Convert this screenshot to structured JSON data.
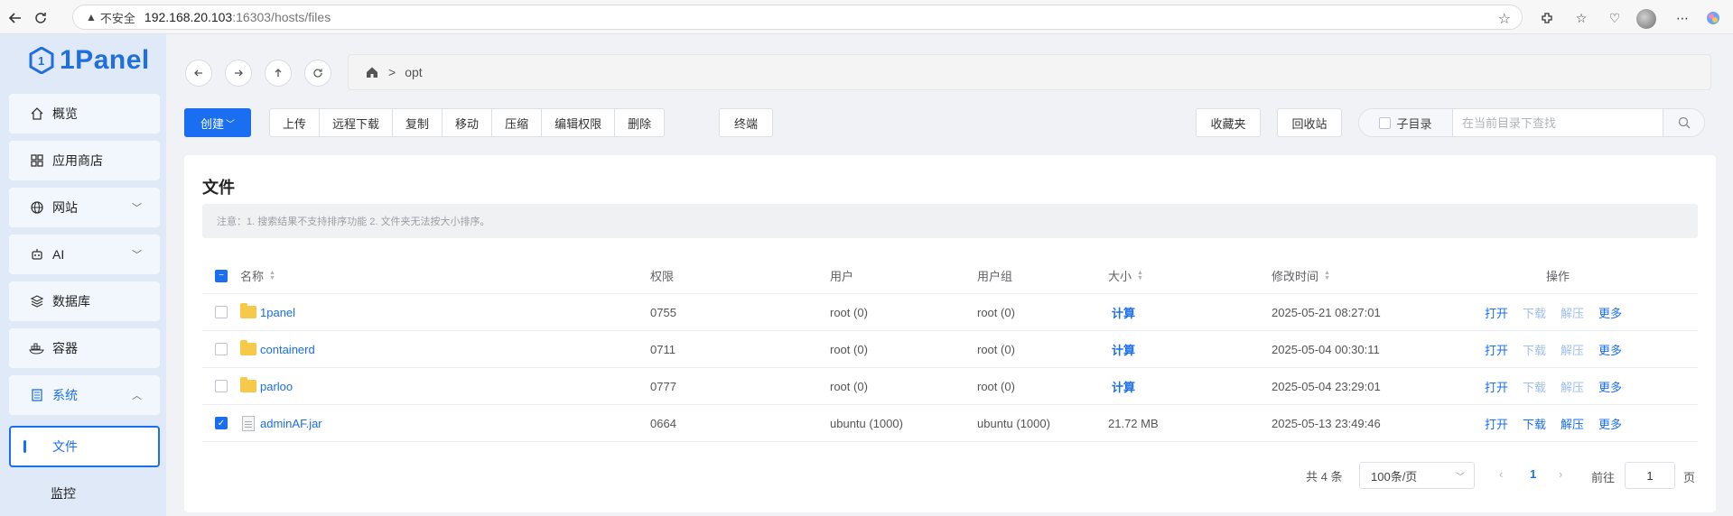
{
  "browser": {
    "insecure_label": "不安全",
    "url_host": "192.168.20.103",
    "url_rest": ":16303/hosts/files"
  },
  "sidebar": {
    "logo_text": "1Panel",
    "items": [
      {
        "label": "概览",
        "icon": "home-icon"
      },
      {
        "label": "应用商店",
        "icon": "apps-grid-icon"
      },
      {
        "label": "网站",
        "icon": "globe-icon"
      },
      {
        "label": "AI",
        "icon": "robot-icon"
      },
      {
        "label": "数据库",
        "icon": "layers-icon"
      },
      {
        "label": "容器",
        "icon": "docker-icon"
      },
      {
        "label": "系统",
        "icon": "server-icon"
      }
    ],
    "sub_items": [
      {
        "label": "文件"
      },
      {
        "label": "监控"
      }
    ]
  },
  "path": {
    "segment": "opt"
  },
  "toolbar": {
    "create_label": "创建",
    "group_buttons": [
      "上传",
      "远程下载",
      "复制",
      "移动",
      "压缩",
      "编辑权限",
      "删除"
    ],
    "terminal_label": "终端",
    "favorites_label": "收藏夹",
    "recycle_label": "回收站",
    "subdir_label": "子目录",
    "search_placeholder": "在当前目录下查找"
  },
  "card": {
    "title": "文件",
    "notice": "注意：1. 搜索结果不支持排序功能 2. 文件夹无法按大小排序。"
  },
  "table": {
    "headers": {
      "name": "名称",
      "perm": "权限",
      "user": "用户",
      "group": "用户组",
      "size": "大小",
      "mtime": "修改时间",
      "ops": "操作"
    },
    "rows": [
      {
        "name": "1panel",
        "perm": "0755",
        "user": "root (0)",
        "group": "root (0)",
        "size": "计算",
        "mtime": "2025-05-21 08:27:01",
        "checked": false,
        "type": "folder"
      },
      {
        "name": "containerd",
        "perm": "0711",
        "user": "root (0)",
        "group": "root (0)",
        "size": "计算",
        "mtime": "2025-05-04 00:30:11",
        "checked": false,
        "type": "folder"
      },
      {
        "name": "parloo",
        "perm": "0777",
        "user": "root (0)",
        "group": "root (0)",
        "size": "计算",
        "mtime": "2025-05-04 23:29:01",
        "checked": false,
        "type": "folder"
      },
      {
        "name": "adminAF.jar",
        "perm": "0664",
        "user": "ubuntu (1000)",
        "group": "ubuntu (1000)",
        "size": "21.72 MB",
        "mtime": "2025-05-13 23:49:46",
        "checked": true,
        "type": "file"
      }
    ],
    "actions": [
      "打开",
      "下载",
      "解压",
      "更多"
    ]
  },
  "pagination": {
    "total_label": "共 4 条",
    "page_size": "100条/页",
    "current_page": "1",
    "goto_prefix": "前往",
    "goto_value": "1",
    "goto_suffix": "页"
  },
  "colors": {
    "primary": "#1a6ef0",
    "sidebar_bg": "#dfe9f7",
    "folder": "#f7c948"
  }
}
